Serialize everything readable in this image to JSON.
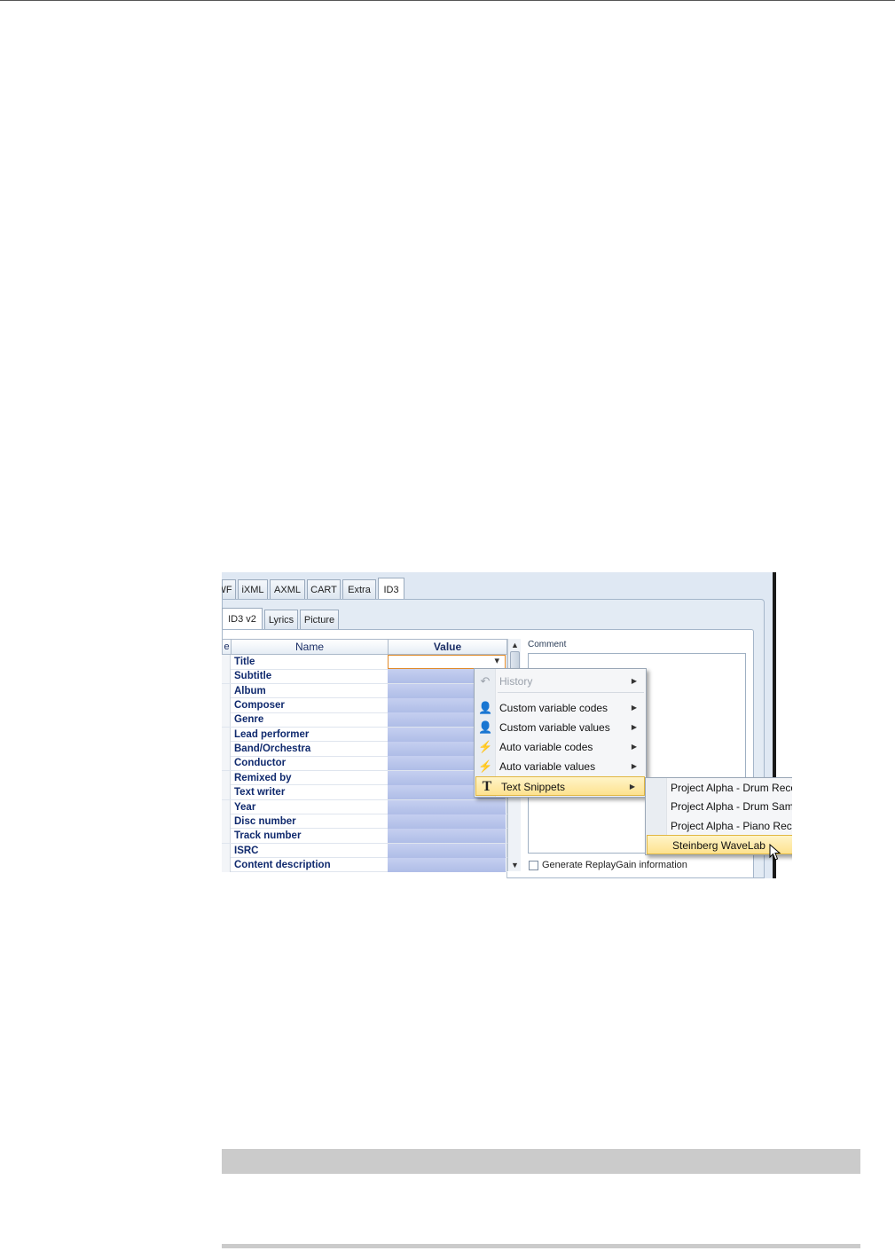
{
  "tabs": [
    "WF",
    "iXML",
    "AXML",
    "CART",
    "Extra",
    "ID3"
  ],
  "active_tab": "ID3",
  "subtabs": [
    "ID3 v2",
    "Lyrics",
    "Picture"
  ],
  "active_subtab": "ID3 v2",
  "grid": {
    "col_left": "e",
    "col_name": "Name",
    "col_value": "Value",
    "rows": [
      {
        "name": "Title"
      },
      {
        "name": "Subtitle"
      },
      {
        "name": "Album"
      },
      {
        "name": "Composer"
      },
      {
        "name": "Genre"
      },
      {
        "name": "Lead performer"
      },
      {
        "name": "Band/Orchestra"
      },
      {
        "name": "Conductor"
      },
      {
        "name": "Remixed by"
      },
      {
        "name": "Text writer"
      },
      {
        "name": "Year"
      },
      {
        "name": "Disc number"
      },
      {
        "name": "Track number"
      },
      {
        "name": "ISRC"
      },
      {
        "name": "Content description"
      }
    ]
  },
  "comment_label": "Comment",
  "replaygain_label": "Generate ReplayGain information",
  "context_menu": {
    "items": [
      {
        "label": "History",
        "icon": "undo-icon",
        "disabled": true
      },
      {
        "label": "Custom variable codes",
        "icon": "user-code-icon"
      },
      {
        "label": "Custom variable values",
        "icon": "user-value-icon"
      },
      {
        "label": "Auto variable codes",
        "icon": "auto-code-icon"
      },
      {
        "label": "Auto variable values",
        "icon": "auto-value-icon"
      },
      {
        "label": "Text Snippets",
        "icon": "text-t-icon",
        "highlighted": true
      }
    ]
  },
  "submenu": {
    "items": [
      {
        "label": "Project Alpha - Drum Recording"
      },
      {
        "label": "Project Alpha - Drum Sample"
      },
      {
        "label": "Project Alpha - Piano Recording"
      },
      {
        "label": "Steinberg WaveLab",
        "highlighted": true
      }
    ]
  },
  "colors": {
    "highlight": "#fde28f",
    "value_cell": "#b9c5ec",
    "panel_bg": "#dfe8f3"
  }
}
